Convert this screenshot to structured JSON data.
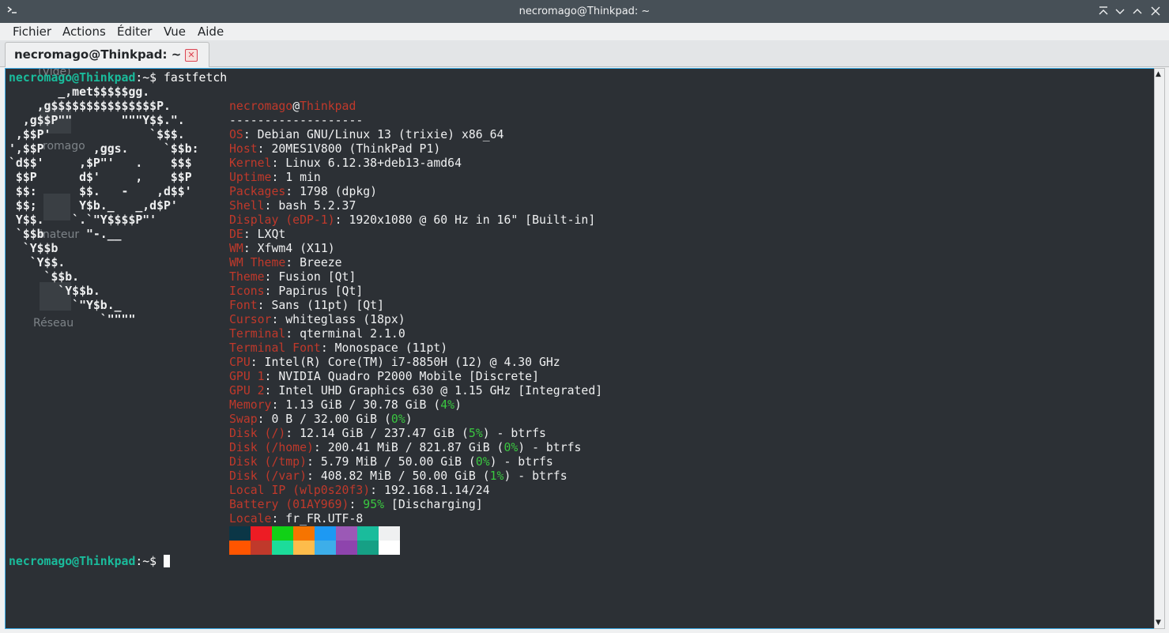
{
  "window": {
    "title": "necromago@Thinkpad: ~"
  },
  "menu": [
    "Fichier",
    "Actions",
    "Éditer",
    "Vue",
    "Aide"
  ],
  "tab": {
    "label": "necromago@Thinkpad: ~"
  },
  "prompt": {
    "user_host": "necromago@Thinkpad",
    "path": ":~$ ",
    "command": "fastfetch"
  },
  "desktop_ghosts": [
    "(Vide)",
    "romago",
    "inateur",
    "Réseau"
  ],
  "ascii_logo": [
    "       _,met$$$$$gg.",
    "    ,g$$$$$$$$$$$$$$$P.",
    "  ,g$$P\"\"       \"\"\"Y$$.\".",
    " ,$$P'              `$$$.",
    "',$$P       ,ggs.     `$$b:",
    "`d$$'     ,$P\"'   .    $$$",
    " $$P      d$'     ,    $$P",
    " $$:      $$.   -    ,d$$'",
    " $$;      Y$b._   _,d$P'",
    " Y$$.    `.`\"Y$$$$P\"'",
    " `$$b      \"-.__",
    "  `Y$$b",
    "   `Y$$.",
    "     `$$b.",
    "       `Y$$b.",
    "         `\"Y$b._",
    "             `\"\"\"\""
  ],
  "header": {
    "user": "necromago",
    "at": "@",
    "host": "Thinkpad",
    "separator": "-------------------"
  },
  "info": [
    {
      "key": "OS",
      "value": ": Debian GNU/Linux 13 (trixie) x86_64"
    },
    {
      "key": "Host",
      "value": ": 20MES1V800 (ThinkPad P1)"
    },
    {
      "key": "Kernel",
      "value": ": Linux 6.12.38+deb13-amd64"
    },
    {
      "key": "Uptime",
      "value": ": 1 min"
    },
    {
      "key": "Packages",
      "value": ": 1798 (dpkg)"
    },
    {
      "key": "Shell",
      "value": ": bash 5.2.37"
    },
    {
      "key": "Display (eDP-1)",
      "value": ": 1920x1080 @ 60 Hz in 16\" [Built-in]"
    },
    {
      "key": "DE",
      "value": ": LXQt"
    },
    {
      "key": "WM",
      "value": ": Xfwm4 (X11)"
    },
    {
      "key": "WM Theme",
      "value": ": Breeze"
    },
    {
      "key": "Theme",
      "value": ": Fusion [Qt]"
    },
    {
      "key": "Icons",
      "value": ": Papirus [Qt]"
    },
    {
      "key": "Font",
      "value": ": Sans (11pt) [Qt]"
    },
    {
      "key": "Cursor",
      "value": ": whiteglass (18px)"
    },
    {
      "key": "Terminal",
      "value": ": qterminal 2.1.0"
    },
    {
      "key": "Terminal Font",
      "value": ": Monospace (11pt)"
    },
    {
      "key": "CPU",
      "value": ": Intel(R) Core(TM) i7-8850H (12) @ 4.30 GHz"
    },
    {
      "key": "GPU 1",
      "value": ": NVIDIA Quadro P2000 Mobile [Discrete]"
    },
    {
      "key": "GPU 2",
      "value": ": Intel UHD Graphics 630 @ 1.15 GHz [Integrated]"
    },
    {
      "key": "Memory",
      "value": ": 1.13 GiB / 30.78 GiB (",
      "pct": "4%",
      "tail": ")"
    },
    {
      "key": "Swap",
      "value": ": 0 B / 32.00 GiB (",
      "pct": "0%",
      "tail": ")"
    },
    {
      "key": "Disk (/)",
      "value": ": 12.14 GiB / 237.47 GiB (",
      "pct": "5%",
      "tail": ") - btrfs"
    },
    {
      "key": "Disk (/home)",
      "value": ": 200.41 MiB / 821.87 GiB (",
      "pct": "0%",
      "tail": ") - btrfs"
    },
    {
      "key": "Disk (/tmp)",
      "value": ": 5.79 MiB / 50.00 GiB (",
      "pct": "0%",
      "tail": ") - btrfs"
    },
    {
      "key": "Disk (/var)",
      "value": ": 408.82 MiB / 50.00 GiB (",
      "pct": "1%",
      "tail": ") - btrfs"
    },
    {
      "key": "Local IP (wlp0s20f3)",
      "value": ": 192.168.1.14/24"
    },
    {
      "key": "Battery (01AY969)",
      "value": ": ",
      "pct": "95%",
      "tail": " [Discharging]"
    },
    {
      "key": "Locale",
      "value": ": fr_FR.UTF-8"
    }
  ],
  "palette": {
    "row1": [
      "#0b3646",
      "#ed1c24",
      "#11d116",
      "#f67400",
      "#1d99f3",
      "#9b59b6",
      "#1abc9c",
      "#eff0f1"
    ],
    "row2": [
      "#ff5500",
      "#c0392b",
      "#1cdc9a",
      "#fdbc4b",
      "#3daee9",
      "#8e44ad",
      "#16a085",
      "#ffffff"
    ]
  }
}
